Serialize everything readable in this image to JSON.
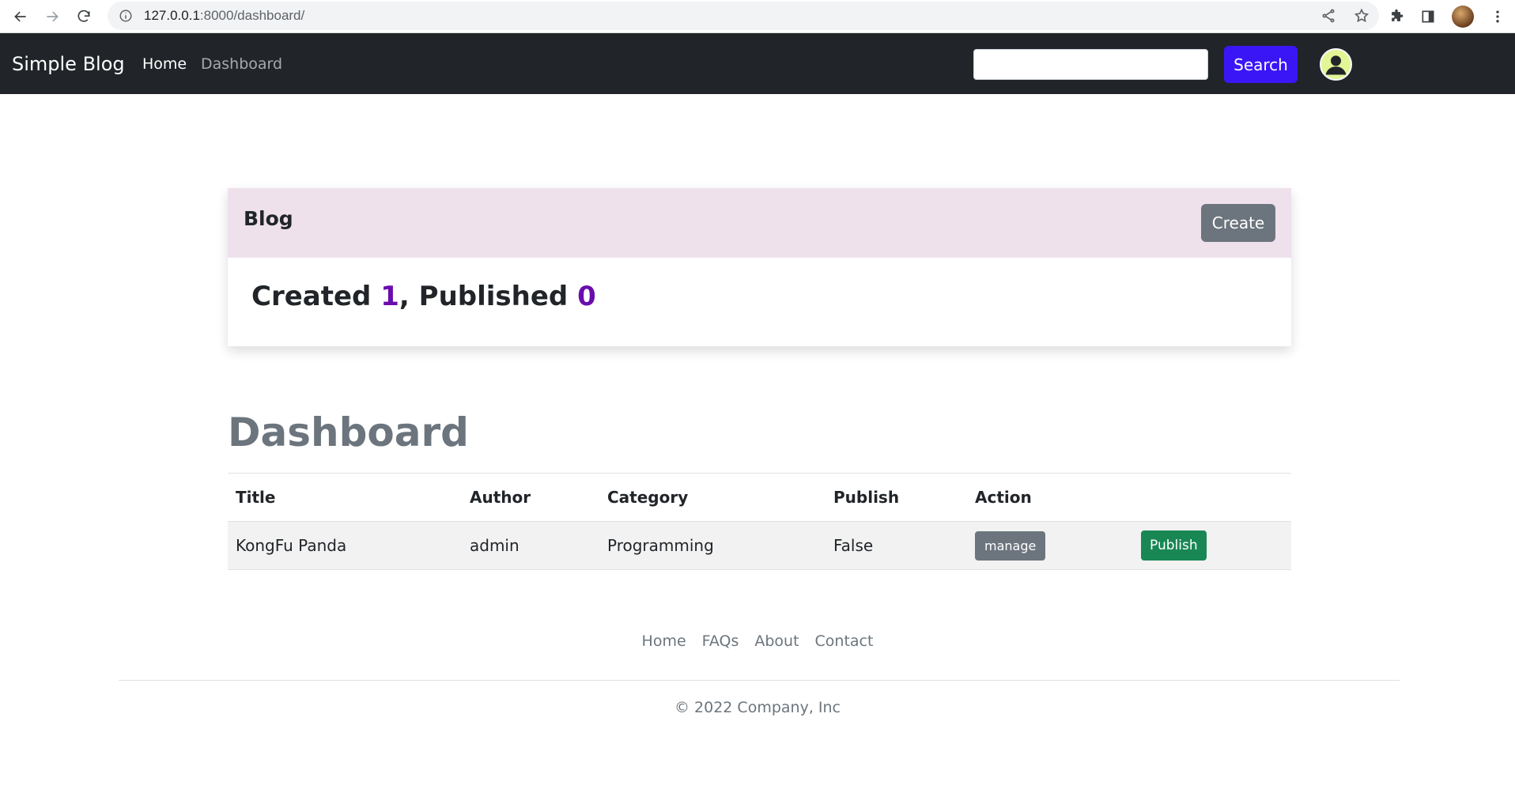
{
  "browser": {
    "url_host": "127.0.0.1",
    "url_rest": ":8000/dashboard/"
  },
  "navbar": {
    "brand": "Simple Blog",
    "links": [
      "Home",
      "Dashboard"
    ],
    "search_button": "Search",
    "search_value": ""
  },
  "card": {
    "title": "Blog",
    "create_button": "Create",
    "stats": {
      "created_label": "Created ",
      "created_count": "1",
      "separator": ", Published ",
      "published_count": "0"
    }
  },
  "dashboard": {
    "heading": "Dashboard",
    "columns": [
      "Title",
      "Author",
      "Category",
      "Publish",
      "Action"
    ],
    "rows": [
      {
        "title": "KongFu Panda",
        "author": "admin",
        "category": "Programming",
        "publish": "False",
        "manage_label": "manage",
        "publish_label": "Publish"
      }
    ]
  },
  "footer": {
    "links": [
      "Home",
      "FAQs",
      "About",
      "Contact"
    ],
    "copyright": "© 2022 Company, Inc"
  },
  "colors": {
    "navbar_bg": "#212529",
    "search_button": "#3a16f7",
    "card_header": "#efe1ec",
    "stat_number": "#6a0dad",
    "publish_button": "#198754",
    "secondary_button": "#6c757d"
  }
}
